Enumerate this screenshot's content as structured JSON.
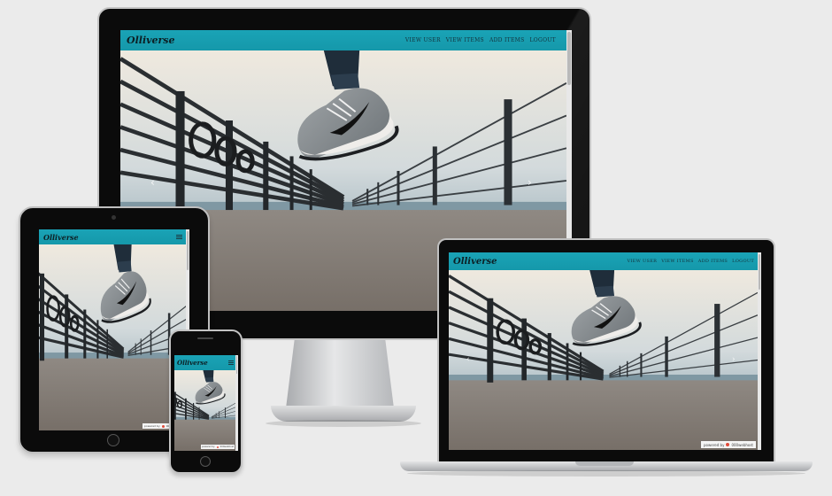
{
  "site": {
    "brand": "Olliverse",
    "nav_links": [
      "VIEW USER",
      "VIEW ITEMS",
      "ADD ITEMS",
      "LOGOUT"
    ],
    "carousel_prev": "‹",
    "carousel_next": "›",
    "credit_prefix": "powered by",
    "credit_name": "000webhost"
  },
  "colors": {
    "navbar": "#1aa3b6",
    "background": "#ebebeb",
    "device_bezel": "#0c0c0c",
    "silver": "#c9cbce"
  },
  "icons": {
    "menu": "hamburger-icon",
    "prev": "chevron-left-icon",
    "next": "chevron-right-icon"
  }
}
